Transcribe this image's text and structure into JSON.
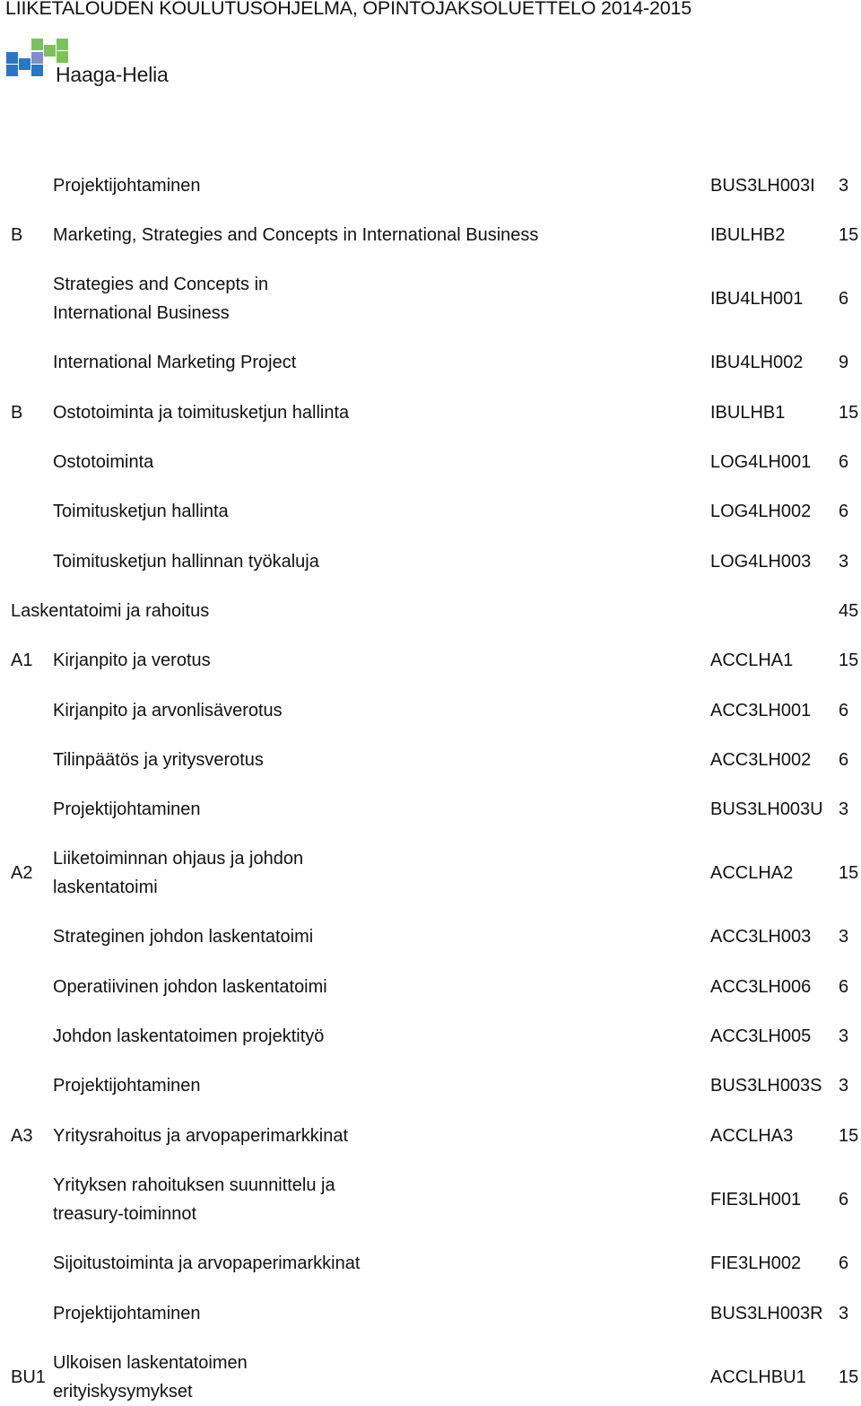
{
  "document": {
    "title": "LIIKETALOUDEN KOULUTUSOHJELMA, OPINTOJAKSOLUETTELO 2014-2015",
    "logo": {
      "text": "Haaga-Helia",
      "colors": {
        "blue": "#2b75c5",
        "purple": "#7e8ec8",
        "green": "#7cc25c"
      }
    }
  },
  "rows": [
    {
      "group": "",
      "name": "Projektijohtaminen",
      "code": "BUS3LH003I",
      "credits": "3"
    },
    {
      "group": "B",
      "name": "Marketing, Strategies and Concepts in International Business",
      "code": "IBULHB2",
      "credits": "15"
    },
    {
      "group": "",
      "name_lines": [
        "Strategies and Concepts in",
        "International Business"
      ],
      "code": "IBU4LH001",
      "credits": "6"
    },
    {
      "group": "",
      "name": "International Marketing Project",
      "code": "IBU4LH002",
      "credits": "9"
    },
    {
      "group": "B",
      "name": "Ostotoiminta ja toimitusketjun hallinta",
      "code": "IBULHB1",
      "credits": "15"
    },
    {
      "group": "",
      "name": "Ostotoiminta",
      "code": "LOG4LH001",
      "credits": "6"
    },
    {
      "group": "",
      "name": "Toimitusketjun hallinta",
      "code": "LOG4LH002",
      "credits": "6"
    },
    {
      "group": "",
      "name": "Toimitusketjun hallinnan työkaluja",
      "code": "LOG4LH003",
      "credits": "3"
    },
    {
      "section": true,
      "name": "Laskentatoimi ja rahoitus",
      "code": "",
      "credits": "45"
    },
    {
      "group": "A1",
      "name": "Kirjanpito ja verotus",
      "code": "ACCLHA1",
      "credits": "15"
    },
    {
      "group": "",
      "name": "Kirjanpito ja arvonlisäverotus",
      "code": "ACC3LH001",
      "credits": "6"
    },
    {
      "group": "",
      "name": "Tilinpäätös ja yritysverotus",
      "code": "ACC3LH002",
      "credits": "6"
    },
    {
      "group": "",
      "name": "Projektijohtaminen",
      "code": "BUS3LH003U",
      "credits": "3"
    },
    {
      "group": "A2",
      "name_lines": [
        "Liiketoiminnan ohjaus ja johdon",
        "laskentatoimi"
      ],
      "code": "ACCLHA2",
      "credits": "15"
    },
    {
      "group": "",
      "name": "Strateginen johdon laskentatoimi",
      "code": "ACC3LH003",
      "credits": "3"
    },
    {
      "group": "",
      "name": "Operatiivinen johdon laskentatoimi",
      "code": "ACC3LH006",
      "credits": "6"
    },
    {
      "group": "",
      "name": "Johdon laskentatoimen projektityö",
      "code": "ACC3LH005",
      "credits": "3"
    },
    {
      "group": "",
      "name": "Projektijohtaminen",
      "code": "BUS3LH003S",
      "credits": "3"
    },
    {
      "group": "A3",
      "name": "Yritysrahoitus ja arvopaperimarkkinat",
      "code": "ACCLHA3",
      "credits": "15"
    },
    {
      "group": "",
      "name_lines": [
        "Yrityksen rahoituksen suunnittelu ja",
        "treasury-toiminnot"
      ],
      "code": "FIE3LH001",
      "credits": "6"
    },
    {
      "group": "",
      "name": "Sijoitustoiminta ja arvopaperimarkkinat",
      "code": "FIE3LH002",
      "credits": "6"
    },
    {
      "group": "",
      "name": "Projektijohtaminen",
      "code": "BUS3LH003R",
      "credits": "3"
    },
    {
      "group": "BU1",
      "name_lines": [
        "Ulkoisen laskentatoimen",
        "erityiskysymykset"
      ],
      "code": "ACCLHBU1",
      "credits": "15"
    }
  ]
}
